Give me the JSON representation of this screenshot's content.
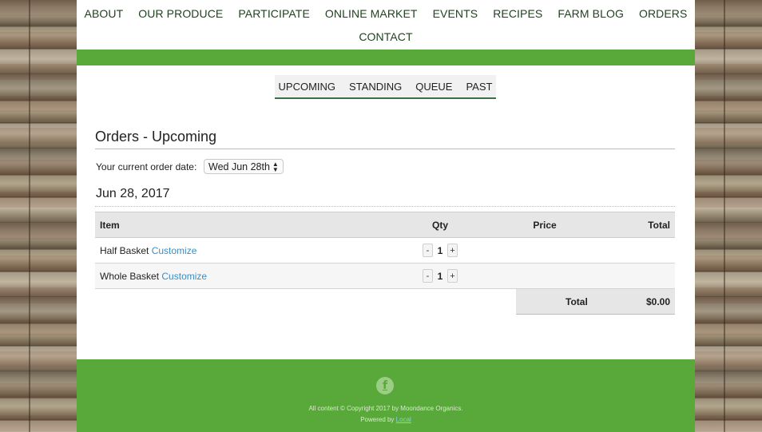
{
  "nav": {
    "items": [
      "ABOUT",
      "OUR PRODUCE",
      "PARTICIPATE",
      "ONLINE MARKET",
      "EVENTS",
      "RECIPES",
      "FARM BLOG",
      "ORDERS"
    ],
    "contact": "CONTACT"
  },
  "subnav": {
    "tabs": [
      "UPCOMING",
      "STANDING",
      "QUEUE",
      "PAST"
    ]
  },
  "page": {
    "title": "Orders - Upcoming",
    "order_date_label": "Your current order date:",
    "order_date_value": "Wed Jun 28th",
    "date_heading": "Jun 28, 2017"
  },
  "table": {
    "headers": {
      "item": "Item",
      "qty": "Qty",
      "price": "Price",
      "total": "Total"
    },
    "rows": [
      {
        "item": "Half Basket",
        "link": "Customize",
        "qty": "1",
        "minus": "-",
        "plus": "+"
      },
      {
        "item": "Whole Basket",
        "link": "Customize",
        "qty": "1",
        "minus": "-",
        "plus": "+"
      }
    ],
    "total_label": "Total",
    "total_value": "$0.00"
  },
  "footer": {
    "facebook_glyph": "f",
    "copyright": "All content © Copyright 2017 by Moondance Organics.",
    "powered_by": "Powered by",
    "powered_link": "Local"
  },
  "colors": {
    "green": "#58a83a",
    "link": "#3b8ec4",
    "nav_text": "#20421f"
  }
}
